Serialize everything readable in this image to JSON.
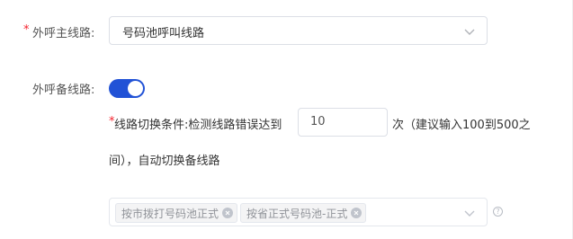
{
  "main_line": {
    "required_mark": "*",
    "label": "外呼主线路:",
    "value": "号码池呼叫线路"
  },
  "backup_line": {
    "label": "外呼备线路:",
    "toggle_on": true
  },
  "condition": {
    "required_mark": "*",
    "prefix": "线路切换条件:检测线路错误达到",
    "count_value": "10",
    "suffix_line1": "次（建议输入100到500之",
    "suffix_line2": "间），自动切换备线路"
  },
  "backup_select": {
    "tags": [
      "按市拨打号码池正式",
      "按省正式号码池-正式"
    ],
    "help_glyph": "?"
  },
  "colors": {
    "accent": "#2152d6",
    "required": "#f5222d",
    "border": "#dcdfe6"
  },
  "icons": {
    "dropdown": "chevron-down-icon",
    "tag_close": "close-icon",
    "help": "question-circle-icon"
  }
}
